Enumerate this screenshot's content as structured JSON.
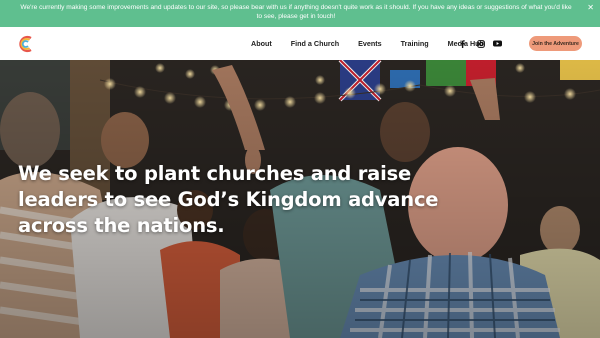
{
  "banner": {
    "text": "We're currently making some improvements and updates to our site, so please bear with us if anything doesn't quite work as it should. If you have any ideas or suggestions of what you'd like to see, please get in touch!",
    "close_icon": "close-icon",
    "color": "#5fbf8f"
  },
  "nav": {
    "items": [
      "About",
      "Find a Church",
      "Events",
      "Training",
      "Media Hub"
    ],
    "social_icons": [
      "facebook-icon",
      "instagram-icon",
      "youtube-icon"
    ],
    "cta_label": "Join the Adventure",
    "cta_color": "#ee9a7a"
  },
  "hero": {
    "headline": "We seek to plant churches and raise leaders to see God’s Kingdom advance across the nations."
  }
}
